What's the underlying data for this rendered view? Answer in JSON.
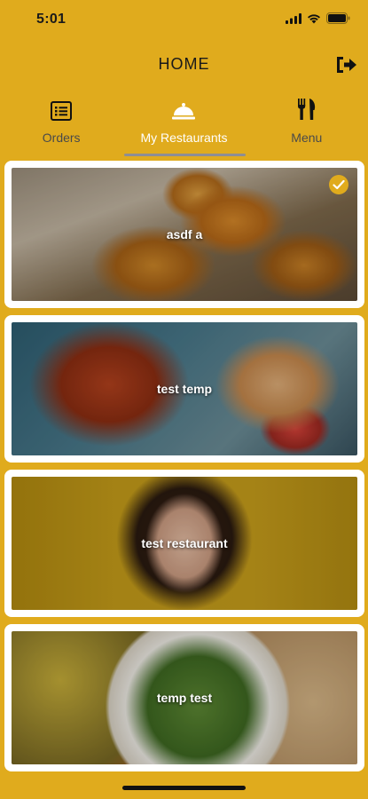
{
  "status_bar": {
    "time": "5:01"
  },
  "header": {
    "title": "HOME"
  },
  "tabs": [
    {
      "label": "Orders",
      "icon": "list-icon",
      "active": false
    },
    {
      "label": "My Restaurants",
      "icon": "cloche-icon",
      "active": true
    },
    {
      "label": "Menu",
      "icon": "fork-knife-icon",
      "active": false
    }
  ],
  "restaurants": [
    {
      "name": "asdf a",
      "selected": true
    },
    {
      "name": "test temp",
      "selected": false
    },
    {
      "name": "test restaurant",
      "selected": false
    },
    {
      "name": "temp test",
      "selected": false
    }
  ],
  "colors": {
    "background": "#E0AB1D",
    "card": "#FFFFFF",
    "active_tab_text": "#FFFFFF",
    "inactive_tab_text": "#4A4A4A"
  }
}
